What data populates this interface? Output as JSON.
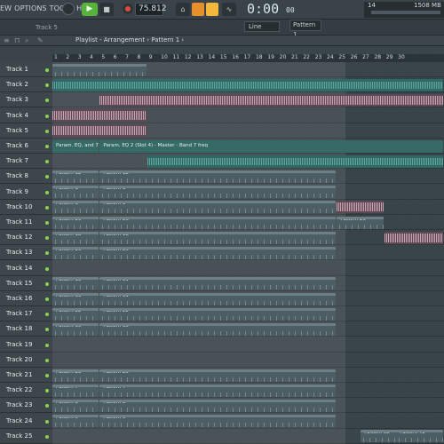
{
  "menu": [
    "EW",
    "OPTIONS",
    "TOOLS",
    "HELP"
  ],
  "transport": {
    "tempo": "75.812",
    "time": "0:00",
    "time_ms": "00",
    "play_icon": "play-icon",
    "stop_icon": "stop-icon",
    "record_icon": "record-icon"
  },
  "performance": {
    "cpu": "14",
    "memory": "1508 MB",
    "voices": "0"
  },
  "toolbar2": {
    "track_hint": "Track 5",
    "snap": "Line",
    "pattern": "Pattern 1"
  },
  "playlist": {
    "title": "Playlist - Arrangement › Pattern 1 ›"
  },
  "tracks": [
    "Track 1",
    "Track 2",
    "Track 3",
    "Track 4",
    "Track 5",
    "Track 6",
    "Track 7",
    "Track 8",
    "Track 9",
    "Track 10",
    "Track 11",
    "Track 12",
    "Track 13",
    "Track 14",
    "Track 15",
    "Track 16",
    "Track 17",
    "Track 18",
    "Track 19",
    "Track 20",
    "Track 21",
    "Track 22",
    "Track 23",
    "Track 24",
    "Track 25"
  ],
  "ruler": [
    "1",
    "2",
    "3",
    "4",
    "5",
    "6",
    "7",
    "8",
    "9",
    "10",
    "11",
    "12",
    "13",
    "14",
    "15",
    "16",
    "17",
    "18",
    "19",
    "20",
    "21",
    "22",
    "23",
    "24",
    "25",
    "26",
    "27",
    "28",
    "29",
    "30"
  ],
  "automation": {
    "clip_a": "Param. EQ, and 7 freq",
    "clip_b": "Param. EQ 2 (Slot 4) - Master - Band 7 freq"
  },
  "clips": {
    "t8a": "Pattern 12",
    "t8b": "Pattern 12",
    "t9a": "Pattern 1",
    "t9b": "Pattern 1",
    "t10a": "Pattern 3",
    "t10b": "Pattern 3",
    "t11a": "Pattern 26",
    "t11b": "Pattern 26",
    "t11c": "Pattern 26",
    "t12a": "Pattern 18",
    "t12b": "Pattern 18",
    "t13a": "Pattern 20",
    "t13b": "Pattern 20",
    "t15a": "Pattern 19",
    "t15b": "Pattern 19",
    "t16a": "Pattern 11",
    "t16b": "Pattern 11",
    "t17a": "Pattern 22",
    "t17b": "Pattern 22",
    "t18a": "Pattern 30",
    "t18b": "Pattern 30",
    "t21a": "Pattern 25",
    "t21b": "Pattern 25",
    "t22a": "Pattern 7",
    "t22b": "Pattern 7",
    "t23a": "Pattern 8",
    "t23b": "Pattern 8",
    "t24a": "Pattern 9",
    "t24b": "Pattern 9",
    "t25a": "Pattern 63",
    "t25b": "Pattern 41"
  },
  "colors": {
    "accent_green": "#57b33e",
    "accent_orange": "#e6902c",
    "clip": "#4d5d64",
    "audio_teal": "#2f6864",
    "audio_pink": "#5d4953"
  }
}
